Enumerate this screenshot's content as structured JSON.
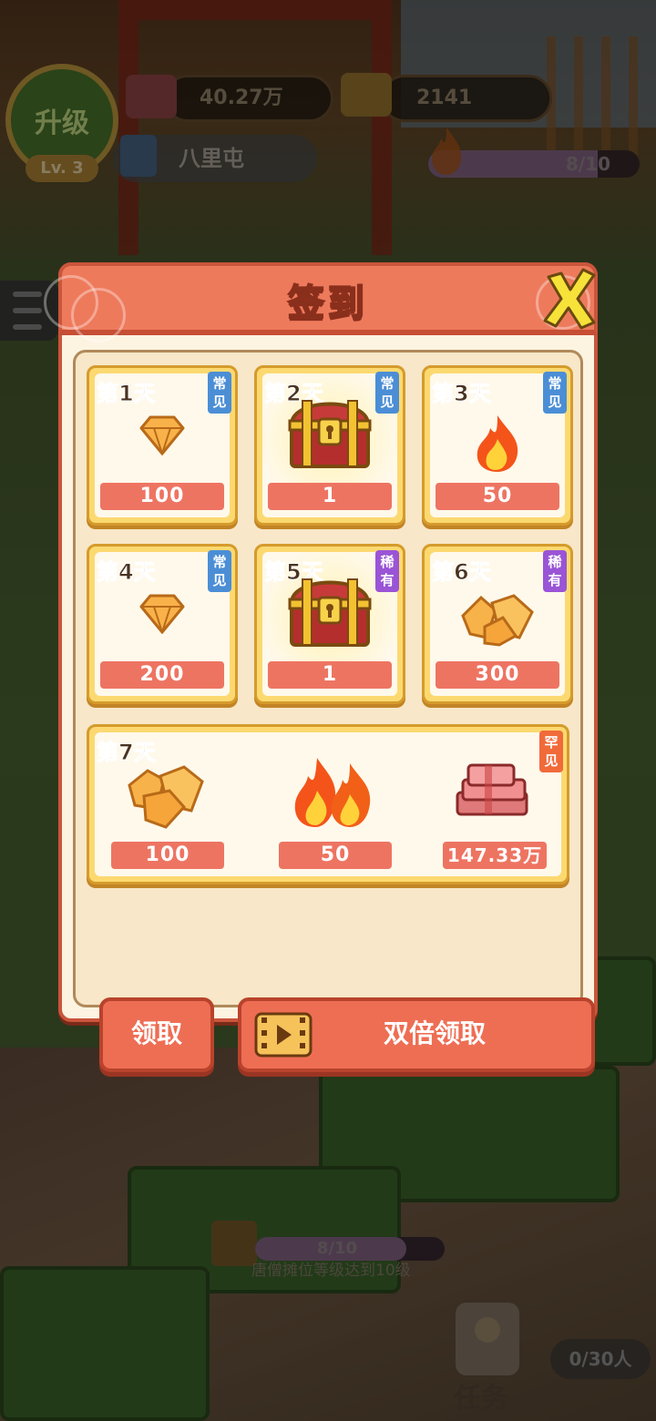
{
  "hud": {
    "level_badge_label": "升级",
    "level": "Lv. 3",
    "cash": "40.27万",
    "gems": "2141",
    "location": "八里屯",
    "fire_progress": "8/10",
    "fire_progress_ratio": 0.8
  },
  "task": {
    "progress": "8/10",
    "progress_ratio": 0.8,
    "description": "唐僧摊位等级达到10级",
    "button_label": "任务",
    "people": "0/30人"
  },
  "dialog": {
    "title": "签到",
    "days": [
      {
        "label": "第1天",
        "rarity": "常见",
        "rarity_type": "common",
        "reward_icon": "gem-icon",
        "amount": "100"
      },
      {
        "label": "第2天",
        "rarity": "常见",
        "rarity_type": "common",
        "reward_icon": "treasure-chest-icon",
        "amount": "1"
      },
      {
        "label": "第3天",
        "rarity": "常见",
        "rarity_type": "common",
        "reward_icon": "fire-icon",
        "amount": "50"
      },
      {
        "label": "第4天",
        "rarity": "常见",
        "rarity_type": "common",
        "reward_icon": "gem-icon",
        "amount": "200"
      },
      {
        "label": "第5天",
        "rarity": "稀有",
        "rarity_type": "rare",
        "reward_icon": "treasure-chest-icon",
        "amount": "1"
      },
      {
        "label": "第6天",
        "rarity": "稀有",
        "rarity_type": "rare",
        "reward_icon": "gem-pile-icon",
        "amount": "300"
      }
    ],
    "day7": {
      "label": "第7天",
      "rarity": "罕见",
      "rewards": [
        {
          "icon": "gem-pile-icon",
          "amount": "100"
        },
        {
          "icon": "double-fire-icon",
          "amount": "50"
        },
        {
          "icon": "cash-stack-icon",
          "amount": "147.33万"
        }
      ]
    },
    "claim_button": "领取",
    "double_claim_button": "双倍领取"
  },
  "colors": {
    "header": "#ee7a5c",
    "ribbon": "#ee7462",
    "card_border": "#fcd970",
    "common": "#4b8ed6",
    "rare": "#9a54d6",
    "legend": "#f16a3a"
  }
}
